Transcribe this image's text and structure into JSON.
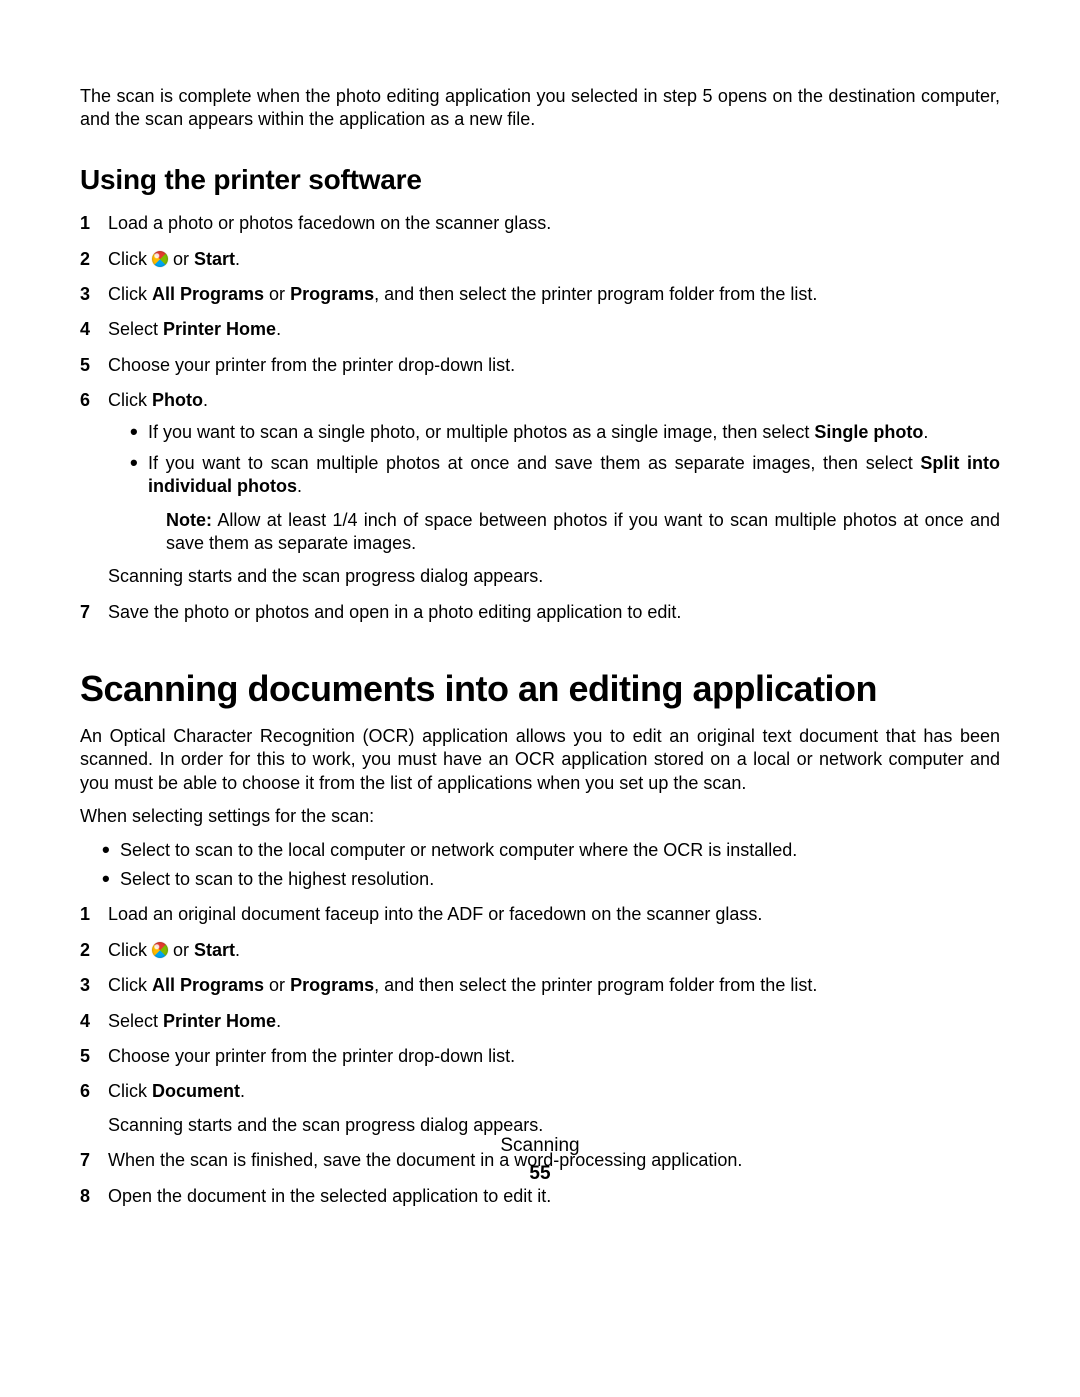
{
  "intro": "The scan is complete when the photo editing application you selected in step 5 opens on the destination computer, and the scan appears within the application as a new file.",
  "section1": {
    "title": "Using the printer software",
    "s1": "Load a photo or photos facedown on the scanner glass.",
    "s2_a": "Click ",
    "s2_b": " or ",
    "s2_c": "Start",
    "s2_d": ".",
    "s3_a": "Click ",
    "s3_b": "All Programs",
    "s3_c": " or ",
    "s3_d": "Programs",
    "s3_e": ", and then select the printer program folder from the list.",
    "s4_a": "Select ",
    "s4_b": "Printer Home",
    "s4_c": ".",
    "s5": "Choose your printer from the printer drop-down list.",
    "s6_a": "Click ",
    "s6_b": "Photo",
    "s6_c": ".",
    "b1_a": "If you want to scan a single photo, or multiple photos as a single image, then select ",
    "b1_b": "Single photo",
    "b1_c": ".",
    "b2_a": "If you want to scan multiple photos at once and save them as separate images, then select ",
    "b2_b": "Split into individual photos",
    "b2_c": ".",
    "note_a": "Note:",
    "note_b": " Allow at least 1/4 inch of space between photos if you want to scan multiple photos at once and save them as separate images.",
    "after6": "Scanning starts and the scan progress dialog appears.",
    "s7": "Save the photo or photos and open in a photo editing application to edit."
  },
  "section2": {
    "title": "Scanning documents into an editing application",
    "p1": "An Optical Character Recognition (OCR) application allows you to edit an original text document that has been scanned. In order for this to work, you must have an OCR application stored on a local or network computer and you must be able to choose it from the list of applications when you set up the scan.",
    "p2": "When selecting settings for the scan:",
    "b1": "Select to scan to the local computer or network computer where the OCR is installed.",
    "b2": "Select to scan to the highest resolution.",
    "s1": "Load an original document faceup into the ADF or facedown on the scanner glass.",
    "s2_a": "Click ",
    "s2_b": " or ",
    "s2_c": "Start",
    "s2_d": ".",
    "s3_a": "Click ",
    "s3_b": "All Programs",
    "s3_c": " or ",
    "s3_d": "Programs",
    "s3_e": ", and then select the printer program folder from the list.",
    "s4_a": "Select ",
    "s4_b": "Printer Home",
    "s4_c": ".",
    "s5": "Choose your printer from the printer drop-down list.",
    "s6_a": "Click ",
    "s6_b": "Document",
    "s6_c": ".",
    "after6": "Scanning starts and the scan progress dialog appears.",
    "s7": "When the scan is finished, save the document in a word-processing application.",
    "s8": "Open the document in the selected application to edit it."
  },
  "footer": {
    "section": "Scanning",
    "page": "55"
  }
}
